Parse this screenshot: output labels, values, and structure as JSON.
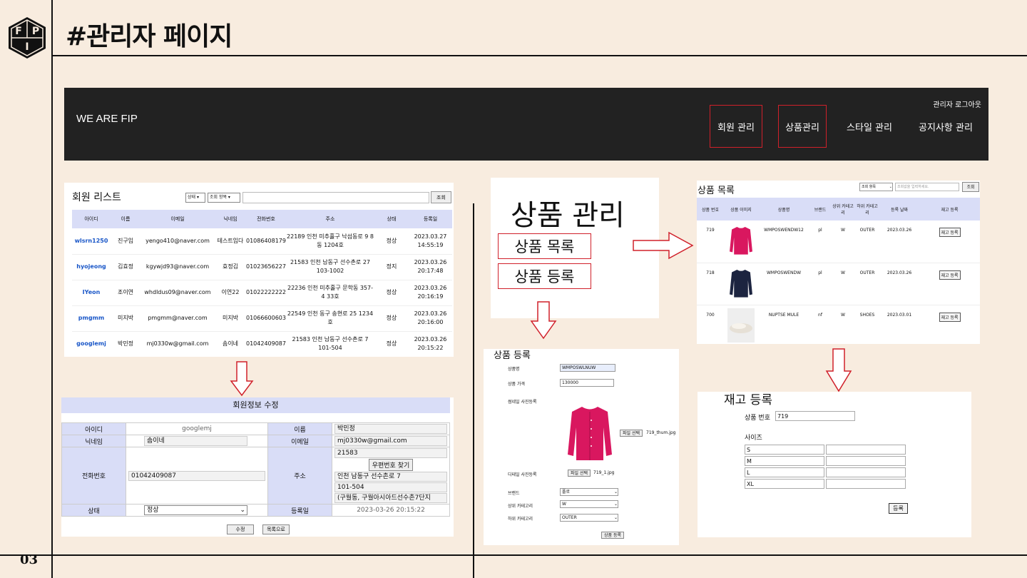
{
  "header": {
    "title": "#관리자 페이지",
    "page_number": "03",
    "logo_text": "FIP"
  },
  "navbar": {
    "brand": "WE ARE FIP",
    "logout": "관리자 로그아웃",
    "items": [
      "회원 관리",
      "상품관리",
      "스타일 관리",
      "공지사항 관리"
    ]
  },
  "member_list": {
    "title": "회원 리스트",
    "filter_status": "상태",
    "filter_field": "조회 항목",
    "search_button": "조회",
    "columns": [
      "아이디",
      "이름",
      "이메일",
      "닉네임",
      "전화번호",
      "주소",
      "상태",
      "등록일"
    ],
    "rows": [
      {
        "id": "wlsrn1250",
        "name": "진구임",
        "email": "yengo410@naver.com",
        "nick": "테스트임다",
        "phone": "01086408179",
        "addr": "22189 인천 미추홀구 낙섬동로 9 8동 1204호",
        "status": "정상",
        "date": "2023.03.27",
        "time": "14:55:19"
      },
      {
        "id": "hyojeong",
        "name": "김효정",
        "email": "kgywjd93@naver.com",
        "nick": "효정김",
        "phone": "01023656227",
        "addr": "21583 인천 남동구 선수촌로 27 103-1002",
        "status": "정지",
        "date": "2023.03.26",
        "time": "20:17:48"
      },
      {
        "id": "IYeon",
        "name": "조이연",
        "email": "whdldus09@naver.com",
        "nick": "이연22",
        "phone": "01022222222",
        "addr": "22236 인천 미추홀구 문학동 357-4 33호",
        "status": "정상",
        "date": "2023.03.26",
        "time": "20:16:19"
      },
      {
        "id": "pmgmm",
        "name": "미지박",
        "email": "pmgmm@naver.com",
        "nick": "미지박",
        "phone": "01066600603",
        "addr": "22549 인천 동구 송현로 25 1234호",
        "status": "정상",
        "date": "2023.03.26",
        "time": "20:16:00"
      },
      {
        "id": "googlemj",
        "name": "박민정",
        "email": "mj0330w@gmail.com",
        "nick": "솜이네",
        "phone": "01042409087",
        "addr": "21583 인천 남동구 선수촌로 7 101-504",
        "status": "정상",
        "date": "2023.03.26",
        "time": "20:15:22"
      }
    ]
  },
  "edit_form": {
    "title": "회원정보 수정",
    "labels": {
      "id": "아이디",
      "name": "이름",
      "nick": "닉네임",
      "email": "이메일",
      "phone": "전화번호",
      "addr": "주소",
      "status": "상태",
      "date": "등록일"
    },
    "values": {
      "id": "googlemj",
      "name": "박민정",
      "nick": "솜이네",
      "email": "mj0330w@gmail.com",
      "zip": "21583",
      "zip_button": "우편번호 찾기",
      "phone": "01042409087",
      "addr1": "인천 남동구 선수촌로 7",
      "addr2": "101-504",
      "addr3": "(구월동, 구월아시아드선수촌7단지",
      "status": "정상",
      "date": "2023-03-26 20:15:22"
    },
    "buttons": {
      "edit": "수정",
      "back": "목록으로"
    }
  },
  "product_menu": {
    "title": "상품 관리",
    "items": [
      "상품 목록",
      "상품 등록"
    ]
  },
  "product_register": {
    "title": "상품 등록",
    "labels": {
      "name": "상품명",
      "price": "상품 가격",
      "thumb": "썸네일 사진등록",
      "detail": "디테일 사진등록",
      "brand": "브랜드",
      "top_cat": "상위 카테고리",
      "sub_cat": "하위 카테고리"
    },
    "values": {
      "name": "WMPOSWLNUW",
      "price": "130000",
      "file_button": "파일 선택",
      "thumb_file": "719_thum.jpg",
      "detail_file": "719_1.jpg",
      "brand": "폴로",
      "top_cat": "W",
      "sub_cat": "OUTER"
    },
    "submit": "상품 등록"
  },
  "product_list": {
    "title": "상품 목록",
    "filter": "조회 항목",
    "placeholder": "조회값을 입력하세요.",
    "search_button": "조회",
    "columns": [
      "상품 번호",
      "상품 이미지",
      "상품명",
      "브랜드",
      "상위 카테고리",
      "하위 카테고리",
      "등록 날짜",
      "재고 등록"
    ],
    "rows": [
      {
        "no": "719",
        "name": "WMPOSWENDW12",
        "brand": "pl",
        "top": "W",
        "sub": "OUTER",
        "date": "2023.03.26",
        "btn": "재고 등록"
      },
      {
        "no": "718",
        "name": "WMPOSWENDW",
        "brand": "pl",
        "top": "W",
        "sub": "OUTER",
        "date": "2023.03.26",
        "btn": "재고 등록"
      },
      {
        "no": "700",
        "name": "NUPTSE MULE",
        "brand": "nf",
        "top": "W",
        "sub": "SHOES",
        "date": "2023.03.01",
        "btn": "재고 등록"
      }
    ]
  },
  "stock_register": {
    "title": "재고 등록",
    "product_no_label": "상품 번호",
    "product_no": "719",
    "size_label": "사이즈",
    "sizes": [
      "S",
      "M",
      "L",
      "XL"
    ],
    "submit": "등록"
  },
  "colors": {
    "accent_red": "#d0202a",
    "header_blue": "#d9ddf7",
    "navbar": "#222222",
    "background": "#f8ecdf",
    "magenta": "#d9175f",
    "navy": "#1c2440"
  }
}
